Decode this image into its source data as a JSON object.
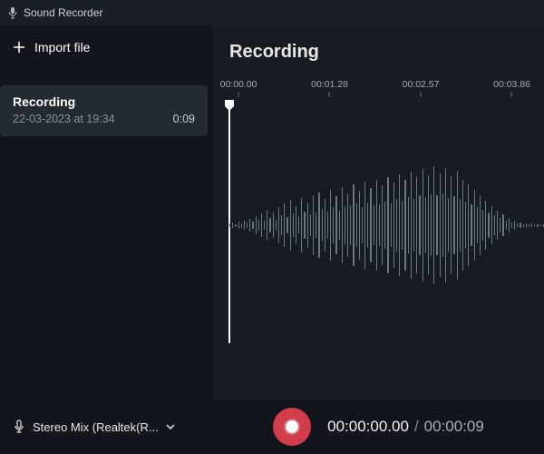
{
  "app": {
    "title": "Sound Recorder"
  },
  "sidebar": {
    "import_label": "Import file",
    "items": [
      {
        "title": "Recording",
        "date": "22-03-2023 at 19:34",
        "duration": "0:09"
      }
    ]
  },
  "content": {
    "title": "Recording",
    "ticks": [
      "00:00.00",
      "00:01.28",
      "00:02.57",
      "00:03.86"
    ],
    "tick_positions_pct": [
      3,
      33,
      63,
      93
    ]
  },
  "bottom": {
    "device_label": "Stereo Mix (Realtek(R...",
    "current_time": "00:00:00.00",
    "total_time": "00:00:09"
  },
  "colors": {
    "accent": "#d13d4b"
  },
  "waveform": [
    4,
    6,
    3,
    8,
    5,
    10,
    6,
    14,
    8,
    20,
    12,
    26,
    10,
    34,
    16,
    28,
    12,
    40,
    22,
    48,
    18,
    56,
    26,
    42,
    20,
    60,
    30,
    50,
    24,
    66,
    28,
    72,
    36,
    58,
    30,
    78,
    40,
    64,
    32,
    84,
    42,
    70,
    44,
    90,
    48,
    76,
    40,
    96,
    50,
    82,
    44,
    100,
    46,
    88,
    52,
    106,
    48,
    94,
    58,
    112,
    54,
    100,
    62,
    118,
    58,
    106,
    66,
    124,
    62,
    110,
    68,
    130,
    66,
    114,
    70,
    126,
    60,
    108,
    64,
    120,
    58,
    100,
    52,
    90,
    46,
    78,
    40,
    66,
    34,
    54,
    28,
    42,
    22,
    32,
    16,
    24,
    10,
    16,
    6,
    10,
    4,
    6,
    3,
    5,
    3,
    4,
    2,
    3,
    2,
    3
  ]
}
